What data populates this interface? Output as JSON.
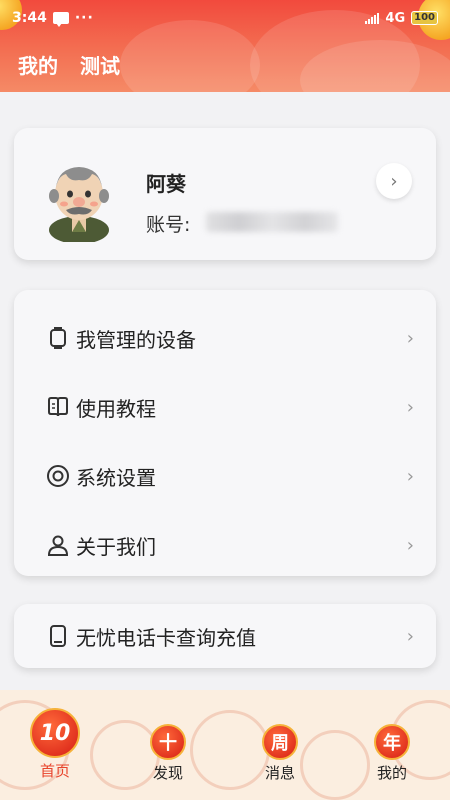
{
  "status_bar": {
    "time": "3:44",
    "dots": "···",
    "network": "4G",
    "battery": "100"
  },
  "header": {
    "tabs": [
      "我的",
      "测试"
    ]
  },
  "profile": {
    "name": "阿葵",
    "account_label": "账号:",
    "arrow": "›"
  },
  "menu": {
    "items": [
      {
        "label": "我管理的设备",
        "icon": "watch-icon"
      },
      {
        "label": "使用教程",
        "icon": "book-icon"
      },
      {
        "label": "系统设置",
        "icon": "settings-ring-icon"
      },
      {
        "label": "关于我们",
        "icon": "person-icon"
      }
    ],
    "chevron": "›"
  },
  "sim": {
    "label": "无忧电话卡查询充值",
    "icon": "phone-card-icon"
  },
  "nav": {
    "items": [
      {
        "label": "首页",
        "badge": "10",
        "active": true
      },
      {
        "label": "发现",
        "badge": "十"
      },
      {
        "label": "消息",
        "badge": "周"
      },
      {
        "label": "我的",
        "badge": "年"
      }
    ]
  },
  "colors": {
    "header_red": "#f24a3d",
    "active_nav": "#e8452d",
    "badge_gold": "#f6b23a"
  }
}
